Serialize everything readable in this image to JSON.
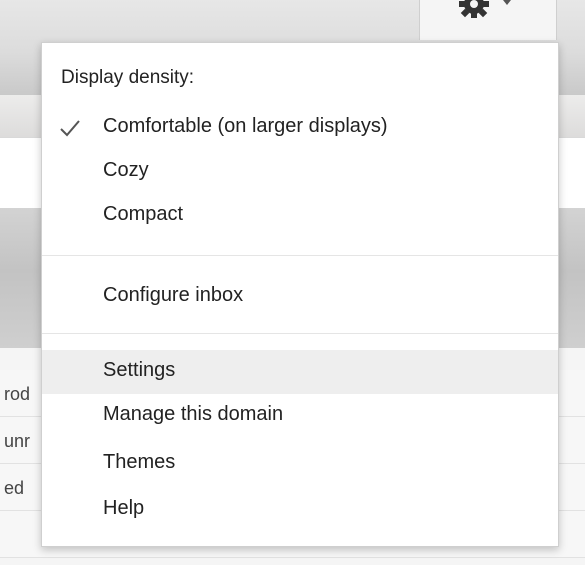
{
  "background": {
    "row_fragments": [
      "rod",
      "unr",
      "ed"
    ]
  },
  "settings_menu": {
    "density_label": "Display density:",
    "density_options": [
      {
        "label": "Comfortable (on larger displays)",
        "selected": true
      },
      {
        "label": "Cozy",
        "selected": false
      },
      {
        "label": "Compact",
        "selected": false
      }
    ],
    "configure_inbox": "Configure inbox",
    "settings": "Settings",
    "manage_domain": "Manage this domain",
    "themes": "Themes",
    "help": "Help",
    "hovered_item": "Settings"
  },
  "icons": {
    "gear": "gear-icon",
    "caret": "caret-down-icon",
    "check": "checkmark-icon"
  },
  "colors": {
    "menu_text": "#222222",
    "hover_bg": "#eeeeee",
    "menu_border": "#cfcfcf"
  }
}
